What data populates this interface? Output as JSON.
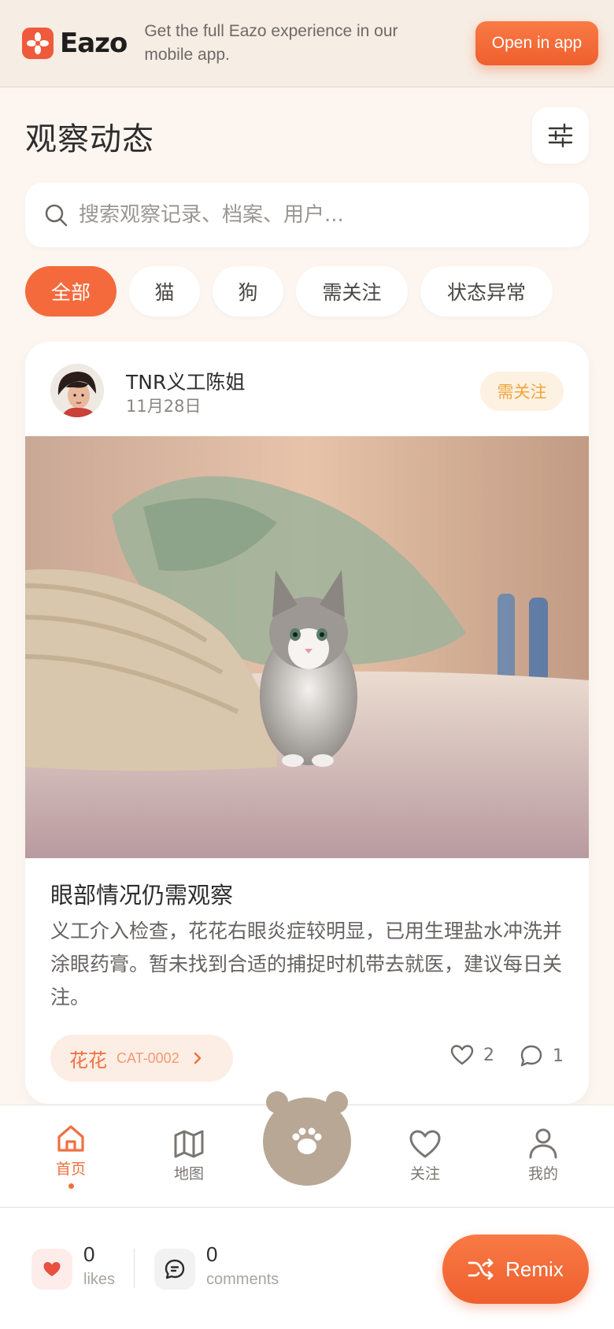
{
  "banner": {
    "brand": "Eazo",
    "message": "Get the full Eazo experience in our mobile app.",
    "open_label": "Open in app"
  },
  "header": {
    "title": "观察动态"
  },
  "search": {
    "placeholder": "搜索观察记录、档案、用户..."
  },
  "filters": [
    {
      "label": "全部",
      "active": true
    },
    {
      "label": "猫",
      "active": false
    },
    {
      "label": "狗",
      "active": false
    },
    {
      "label": "需关注",
      "active": false
    },
    {
      "label": "状态异常",
      "active": false
    }
  ],
  "post": {
    "author": "TNR义工陈姐",
    "date": "11月28日",
    "status_badge": "需关注",
    "title": "眼部情况仍需观察",
    "body": "义工介入检查，花花右眼炎症较明显，已用生理盐水冲洗并涂眼药膏。暂未找到合适的捕捉时机带去就医，建议每日关注。",
    "pet_name": "花花",
    "pet_id": "CAT-0002",
    "likes": "2",
    "comments": "1"
  },
  "nav": {
    "items": [
      {
        "label": "首页",
        "icon": "home-icon",
        "active": true
      },
      {
        "label": "地图",
        "icon": "map-icon",
        "active": false
      },
      {
        "label": "关注",
        "icon": "heart-icon",
        "active": false
      },
      {
        "label": "我的",
        "icon": "user-icon",
        "active": false
      }
    ],
    "center_icon": "paw-icon"
  },
  "footer": {
    "likes_count": "0",
    "likes_label": "likes",
    "comments_count": "0",
    "comments_label": "comments",
    "remix_label": "Remix"
  },
  "colors": {
    "accent": "#f46a3c",
    "background": "#fdf6f0",
    "badge_text": "#f0a53a",
    "bear": "#b9a796"
  }
}
